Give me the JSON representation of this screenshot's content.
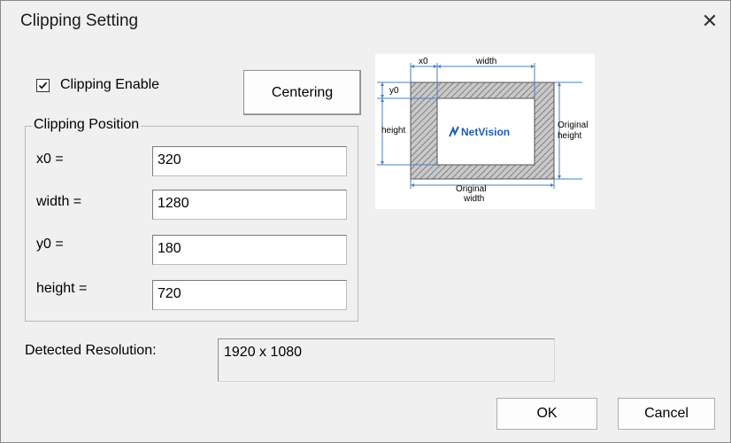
{
  "window": {
    "title": "Clipping Setting"
  },
  "controls": {
    "clipping_enable_label": "Clipping Enable",
    "clipping_enable_checked": true,
    "centering_label": "Centering"
  },
  "group": {
    "title": "Clipping Position",
    "fields": [
      {
        "label": "x0 =",
        "value": "320"
      },
      {
        "label": "width =",
        "value": "1280"
      },
      {
        "label": "y0 =",
        "value": "180"
      },
      {
        "label": "height =",
        "value": "720"
      }
    ]
  },
  "detected": {
    "label": "Detected Resolution:",
    "value": "1920 x 1080"
  },
  "footer": {
    "ok_label": "OK",
    "cancel_label": "Cancel"
  },
  "diagram": {
    "labels": {
      "x0": "x0",
      "width": "width",
      "y0": "y0",
      "height": "height",
      "original_width_1": "Original",
      "original_width_2": "width",
      "original_height_1": "Original",
      "original_height_2": "height",
      "logo_text": "NetVision"
    },
    "colors": {
      "dimension_line": "#4a7fc0",
      "logo": "#1f5fb0",
      "hatch": "#8a8a8a"
    }
  }
}
